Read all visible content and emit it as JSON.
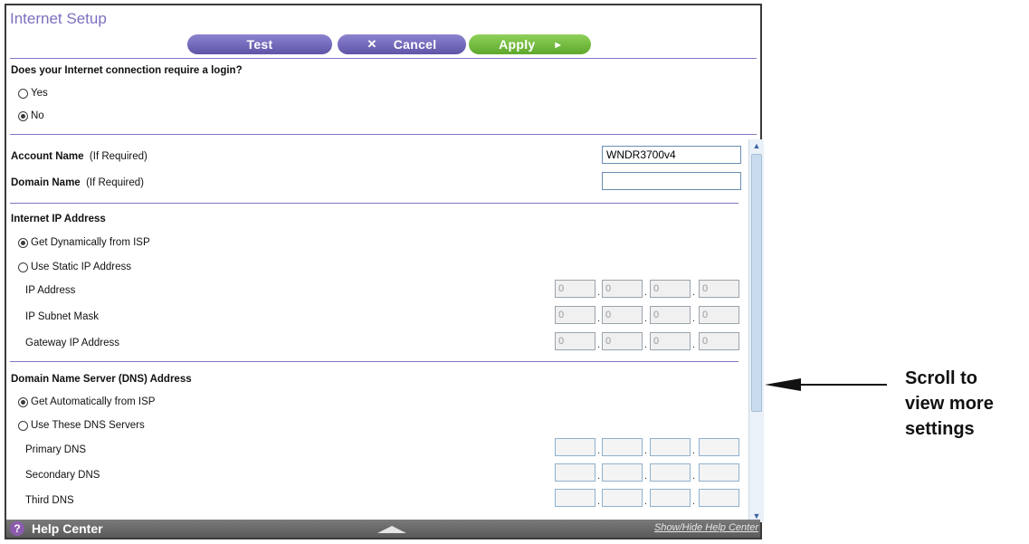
{
  "page": {
    "title": "Internet Setup",
    "buttons": {
      "test": "Test",
      "cancel": "Cancel",
      "apply": "Apply"
    }
  },
  "login": {
    "question": "Does your Internet connection require a login?",
    "options": [
      "Yes",
      "No"
    ],
    "selected": "No"
  },
  "account": {
    "account_label": "Account Name",
    "account_hint": "(If Required)",
    "account_value": "WNDR3700v4",
    "domain_label": "Domain Name",
    "domain_hint": "(If Required)",
    "domain_value": ""
  },
  "ip": {
    "section_title": "Internet IP Address",
    "option_dynamic": "Get Dynamically from ISP",
    "option_static": "Use Static IP Address",
    "selected": "Get Dynamically from ISP",
    "rows": [
      {
        "label": "IP Address",
        "octets": [
          "0",
          "0",
          "0",
          "0"
        ]
      },
      {
        "label": "IP Subnet Mask",
        "octets": [
          "0",
          "0",
          "0",
          "0"
        ]
      },
      {
        "label": "Gateway IP Address",
        "octets": [
          "0",
          "0",
          "0",
          "0"
        ]
      }
    ]
  },
  "dns": {
    "section_title": "Domain Name Server (DNS) Address",
    "option_auto": "Get Automatically from ISP",
    "option_manual": "Use These DNS Servers",
    "selected": "Get Automatically from ISP",
    "rows": [
      {
        "label": "Primary DNS",
        "octets": [
          "",
          "",
          "",
          ""
        ]
      },
      {
        "label": "Secondary DNS",
        "octets": [
          "",
          "",
          "",
          ""
        ]
      },
      {
        "label": "Third DNS",
        "octets": [
          "",
          "",
          "",
          ""
        ]
      }
    ]
  },
  "help": {
    "label": "Help Center",
    "icon": "question-icon",
    "toggle_icon": "triangle-up-icon",
    "show_hide": "Show/Hide Help Center"
  },
  "callout": {
    "lines": [
      "Scroll to",
      "view more",
      "settings"
    ],
    "icon": "left-arrow-icon"
  },
  "colors": {
    "title": "#7c6fbf",
    "purple_button": "#6b62b6",
    "green_button": "#6cb63a",
    "divider": "#8077c4"
  }
}
